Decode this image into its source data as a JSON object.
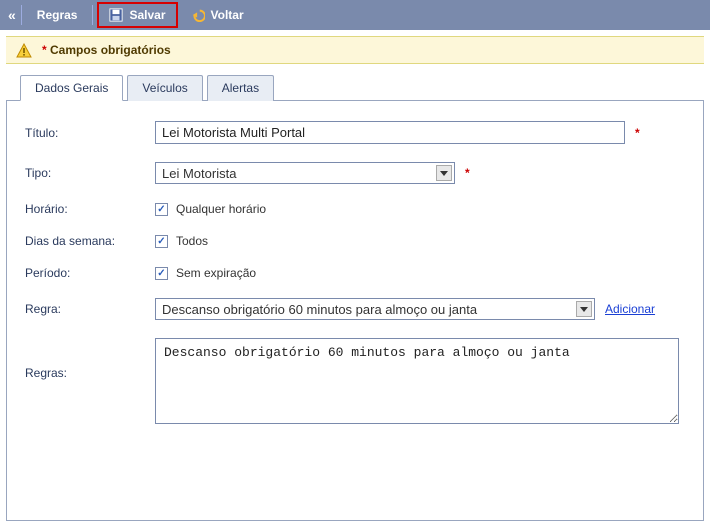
{
  "toolbar": {
    "regras": "Regras",
    "salvar": "Salvar",
    "voltar": "Voltar"
  },
  "notice": {
    "asterisk": "*",
    "text": "Campos obrigatórios"
  },
  "tabs": {
    "dados": "Dados Gerais",
    "veiculos": "Veículos",
    "alertas": "Alertas"
  },
  "labels": {
    "titulo": "Título:",
    "tipo": "Tipo:",
    "horario": "Horário:",
    "dias": "Dias da semana:",
    "periodo": "Período:",
    "regra": "Regra:",
    "regras": "Regras:"
  },
  "values": {
    "titulo": "Lei Motorista Multi Portal",
    "tipo": "Lei Motorista",
    "horario_cb": "Qualquer horário",
    "dias_cb": "Todos",
    "periodo_cb": "Sem expiração",
    "regra_select": "Descanso obrigatório 60 minutos para almoço ou janta",
    "adicionar": "Adicionar",
    "regras_text": "Descanso obrigatório 60 minutos para almoço ou janta"
  },
  "required_asterisk": "*"
}
